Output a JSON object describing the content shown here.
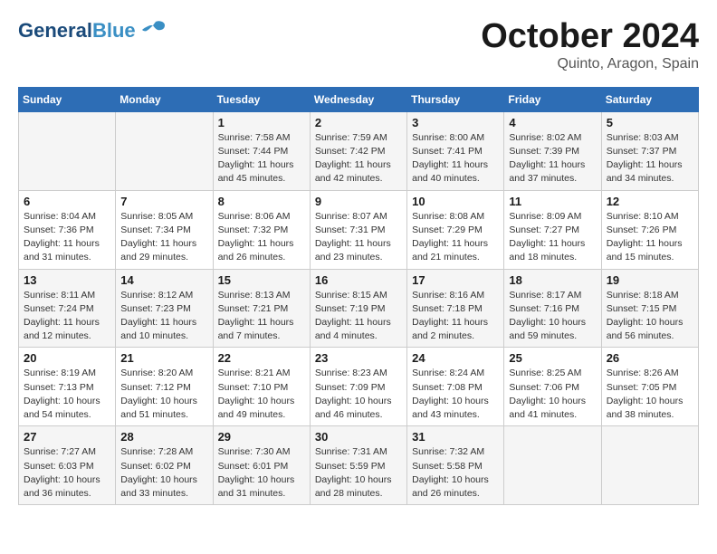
{
  "header": {
    "logo_general": "General",
    "logo_blue": "Blue",
    "month_title": "October 2024",
    "location": "Quinto, Aragon, Spain"
  },
  "days_of_week": [
    "Sunday",
    "Monday",
    "Tuesday",
    "Wednesday",
    "Thursday",
    "Friday",
    "Saturday"
  ],
  "weeks": [
    [
      {
        "day": "",
        "sunrise": "",
        "sunset": "",
        "daylight": ""
      },
      {
        "day": "",
        "sunrise": "",
        "sunset": "",
        "daylight": ""
      },
      {
        "day": "1",
        "sunrise": "Sunrise: 7:58 AM",
        "sunset": "Sunset: 7:44 PM",
        "daylight": "Daylight: 11 hours and 45 minutes."
      },
      {
        "day": "2",
        "sunrise": "Sunrise: 7:59 AM",
        "sunset": "Sunset: 7:42 PM",
        "daylight": "Daylight: 11 hours and 42 minutes."
      },
      {
        "day": "3",
        "sunrise": "Sunrise: 8:00 AM",
        "sunset": "Sunset: 7:41 PM",
        "daylight": "Daylight: 11 hours and 40 minutes."
      },
      {
        "day": "4",
        "sunrise": "Sunrise: 8:02 AM",
        "sunset": "Sunset: 7:39 PM",
        "daylight": "Daylight: 11 hours and 37 minutes."
      },
      {
        "day": "5",
        "sunrise": "Sunrise: 8:03 AM",
        "sunset": "Sunset: 7:37 PM",
        "daylight": "Daylight: 11 hours and 34 minutes."
      }
    ],
    [
      {
        "day": "6",
        "sunrise": "Sunrise: 8:04 AM",
        "sunset": "Sunset: 7:36 PM",
        "daylight": "Daylight: 11 hours and 31 minutes."
      },
      {
        "day": "7",
        "sunrise": "Sunrise: 8:05 AM",
        "sunset": "Sunset: 7:34 PM",
        "daylight": "Daylight: 11 hours and 29 minutes."
      },
      {
        "day": "8",
        "sunrise": "Sunrise: 8:06 AM",
        "sunset": "Sunset: 7:32 PM",
        "daylight": "Daylight: 11 hours and 26 minutes."
      },
      {
        "day": "9",
        "sunrise": "Sunrise: 8:07 AM",
        "sunset": "Sunset: 7:31 PM",
        "daylight": "Daylight: 11 hours and 23 minutes."
      },
      {
        "day": "10",
        "sunrise": "Sunrise: 8:08 AM",
        "sunset": "Sunset: 7:29 PM",
        "daylight": "Daylight: 11 hours and 21 minutes."
      },
      {
        "day": "11",
        "sunrise": "Sunrise: 8:09 AM",
        "sunset": "Sunset: 7:27 PM",
        "daylight": "Daylight: 11 hours and 18 minutes."
      },
      {
        "day": "12",
        "sunrise": "Sunrise: 8:10 AM",
        "sunset": "Sunset: 7:26 PM",
        "daylight": "Daylight: 11 hours and 15 minutes."
      }
    ],
    [
      {
        "day": "13",
        "sunrise": "Sunrise: 8:11 AM",
        "sunset": "Sunset: 7:24 PM",
        "daylight": "Daylight: 11 hours and 12 minutes."
      },
      {
        "day": "14",
        "sunrise": "Sunrise: 8:12 AM",
        "sunset": "Sunset: 7:23 PM",
        "daylight": "Daylight: 11 hours and 10 minutes."
      },
      {
        "day": "15",
        "sunrise": "Sunrise: 8:13 AM",
        "sunset": "Sunset: 7:21 PM",
        "daylight": "Daylight: 11 hours and 7 minutes."
      },
      {
        "day": "16",
        "sunrise": "Sunrise: 8:15 AM",
        "sunset": "Sunset: 7:19 PM",
        "daylight": "Daylight: 11 hours and 4 minutes."
      },
      {
        "day": "17",
        "sunrise": "Sunrise: 8:16 AM",
        "sunset": "Sunset: 7:18 PM",
        "daylight": "Daylight: 11 hours and 2 minutes."
      },
      {
        "day": "18",
        "sunrise": "Sunrise: 8:17 AM",
        "sunset": "Sunset: 7:16 PM",
        "daylight": "Daylight: 10 hours and 59 minutes."
      },
      {
        "day": "19",
        "sunrise": "Sunrise: 8:18 AM",
        "sunset": "Sunset: 7:15 PM",
        "daylight": "Daylight: 10 hours and 56 minutes."
      }
    ],
    [
      {
        "day": "20",
        "sunrise": "Sunrise: 8:19 AM",
        "sunset": "Sunset: 7:13 PM",
        "daylight": "Daylight: 10 hours and 54 minutes."
      },
      {
        "day": "21",
        "sunrise": "Sunrise: 8:20 AM",
        "sunset": "Sunset: 7:12 PM",
        "daylight": "Daylight: 10 hours and 51 minutes."
      },
      {
        "day": "22",
        "sunrise": "Sunrise: 8:21 AM",
        "sunset": "Sunset: 7:10 PM",
        "daylight": "Daylight: 10 hours and 49 minutes."
      },
      {
        "day": "23",
        "sunrise": "Sunrise: 8:23 AM",
        "sunset": "Sunset: 7:09 PM",
        "daylight": "Daylight: 10 hours and 46 minutes."
      },
      {
        "day": "24",
        "sunrise": "Sunrise: 8:24 AM",
        "sunset": "Sunset: 7:08 PM",
        "daylight": "Daylight: 10 hours and 43 minutes."
      },
      {
        "day": "25",
        "sunrise": "Sunrise: 8:25 AM",
        "sunset": "Sunset: 7:06 PM",
        "daylight": "Daylight: 10 hours and 41 minutes."
      },
      {
        "day": "26",
        "sunrise": "Sunrise: 8:26 AM",
        "sunset": "Sunset: 7:05 PM",
        "daylight": "Daylight: 10 hours and 38 minutes."
      }
    ],
    [
      {
        "day": "27",
        "sunrise": "Sunrise: 7:27 AM",
        "sunset": "Sunset: 6:03 PM",
        "daylight": "Daylight: 10 hours and 36 minutes."
      },
      {
        "day": "28",
        "sunrise": "Sunrise: 7:28 AM",
        "sunset": "Sunset: 6:02 PM",
        "daylight": "Daylight: 10 hours and 33 minutes."
      },
      {
        "day": "29",
        "sunrise": "Sunrise: 7:30 AM",
        "sunset": "Sunset: 6:01 PM",
        "daylight": "Daylight: 10 hours and 31 minutes."
      },
      {
        "day": "30",
        "sunrise": "Sunrise: 7:31 AM",
        "sunset": "Sunset: 5:59 PM",
        "daylight": "Daylight: 10 hours and 28 minutes."
      },
      {
        "day": "31",
        "sunrise": "Sunrise: 7:32 AM",
        "sunset": "Sunset: 5:58 PM",
        "daylight": "Daylight: 10 hours and 26 minutes."
      },
      {
        "day": "",
        "sunrise": "",
        "sunset": "",
        "daylight": ""
      },
      {
        "day": "",
        "sunrise": "",
        "sunset": "",
        "daylight": ""
      }
    ]
  ]
}
